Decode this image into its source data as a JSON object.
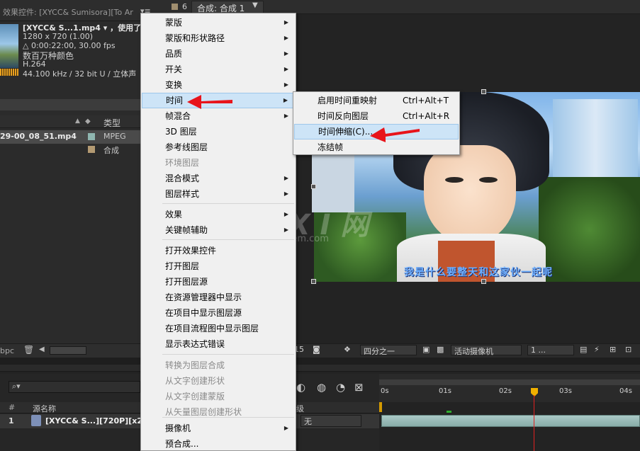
{
  "effect_panel": {
    "tab_title": "效果控件: [XYCC& Sumisora][To Ar",
    "menu_glyph": "▾≡"
  },
  "footage_info": {
    "name": "[XYCC& S...1.mp4 ▾ ，使用了",
    "resolution": "1280 x 720 (1.00)",
    "duration": "△ 0:00:22:00, 30.00 fps",
    "colors": "数百万种颜色",
    "codec": "H.264",
    "audio": "44.100 kHz / 32 bit U / 立体声"
  },
  "project": {
    "column_type": "类型",
    "items": [
      {
        "name": "29-00_08_51.mp4",
        "type": "MPEG",
        "color": "#8fb6b0"
      },
      {
        "name": "",
        "type": "合成",
        "color": "#b39a72"
      }
    ],
    "bpc": "bpc"
  },
  "viewer": {
    "comp_tab": "合成: 合成 1",
    "subtitle": "我是什么要整天和这家伙一起呢",
    "watermark_big": "G X I 网",
    "watermark_small": "system.com",
    "toolbar": {
      "magnification": "15",
      "resolution": "四分之一",
      "camera": "活动摄像机",
      "views": "1 ..."
    }
  },
  "timeline": {
    "search_placeholder": "⌕▾",
    "columns": {
      "num": "#",
      "source": "源名称",
      "parent": "级"
    },
    "ruler_ticks": [
      "0s",
      "01s",
      "02s",
      "03s",
      "04s"
    ],
    "layer": {
      "index": "1",
      "name": "[XYCC& S...][720P][x26",
      "parent": "无"
    }
  },
  "context_menu": {
    "items": [
      {
        "label": "蒙版",
        "submenu": true,
        "disabled": false
      },
      {
        "label": "蒙版和形状路径",
        "submenu": true,
        "disabled": false
      },
      {
        "label": "品质",
        "submenu": true,
        "disabled": false
      },
      {
        "label": "开关",
        "submenu": true,
        "disabled": false
      },
      {
        "label": "变换",
        "submenu": true,
        "disabled": false
      },
      {
        "label": "时间",
        "submenu": true,
        "disabled": false,
        "highlighted": true
      },
      {
        "label": "帧混合",
        "submenu": true,
        "disabled": false
      },
      {
        "label": "3D 图层",
        "submenu": false,
        "disabled": false
      },
      {
        "label": "参考线图层",
        "submenu": false,
        "disabled": false
      },
      {
        "label": "环境图层",
        "submenu": false,
        "disabled": true
      },
      {
        "label": "混合模式",
        "submenu": true,
        "disabled": false
      },
      {
        "label": "图层样式",
        "submenu": true,
        "disabled": false
      },
      {
        "label": "效果",
        "submenu": true,
        "disabled": false
      },
      {
        "label": "关键帧辅助",
        "submenu": true,
        "disabled": false
      },
      {
        "label": "打开效果控件",
        "submenu": false,
        "disabled": false
      },
      {
        "label": "打开图层",
        "submenu": false,
        "disabled": false
      },
      {
        "label": "打开图层源",
        "submenu": false,
        "disabled": false
      },
      {
        "label": "在资源管理器中显示",
        "submenu": false,
        "disabled": false
      },
      {
        "label": "在项目中显示图层源",
        "submenu": false,
        "disabled": false
      },
      {
        "label": "在项目流程图中显示图层",
        "submenu": false,
        "disabled": false
      },
      {
        "label": "显示表达式错误",
        "submenu": false,
        "disabled": false
      },
      {
        "label": "转换为图层合成",
        "submenu": false,
        "disabled": true
      },
      {
        "label": "从文字创建形状",
        "submenu": false,
        "disabled": true
      },
      {
        "label": "从文字创建蒙版",
        "submenu": false,
        "disabled": true
      },
      {
        "label": "从矢量图层创建形状",
        "submenu": false,
        "disabled": true
      },
      {
        "label": "摄像机",
        "submenu": true,
        "disabled": false
      },
      {
        "label": "预合成...",
        "submenu": false,
        "disabled": false
      }
    ]
  },
  "time_submenu": {
    "items": [
      {
        "label": "启用时间重映射",
        "shortcut": "Ctrl+Alt+T"
      },
      {
        "label": "时间反向图层",
        "shortcut": "Ctrl+Alt+R"
      },
      {
        "label": "时间伸缩(C)...",
        "shortcut": "",
        "highlighted": true
      },
      {
        "label": "冻结帧",
        "shortcut": ""
      }
    ]
  },
  "colors": {
    "highlight": "#cde4f7",
    "annotation_arrow": "#e8141b",
    "playhead": "#e02020"
  }
}
